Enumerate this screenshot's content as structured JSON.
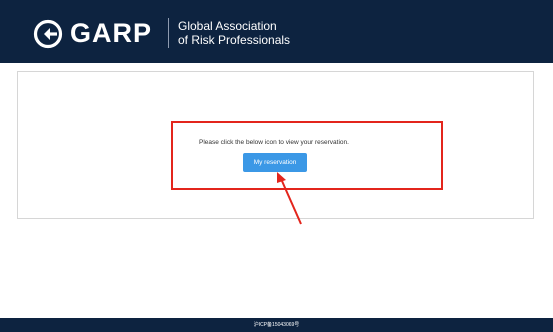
{
  "header": {
    "logo_text": "GARP",
    "tagline_line1": "Global Association",
    "tagline_line2": "of Risk Professionals",
    "background_color": "#0d2340"
  },
  "main": {
    "message": "Please click the below icon to view your reservation.",
    "button_label": "My reservation",
    "button_color": "#3b98e6",
    "highlight_color": "#e3251c"
  },
  "footer": {
    "text": "沪ICP备15043069号"
  },
  "icons": {
    "logo": "garp-logo-icon",
    "annotation_arrow": "red-arrow-icon"
  }
}
